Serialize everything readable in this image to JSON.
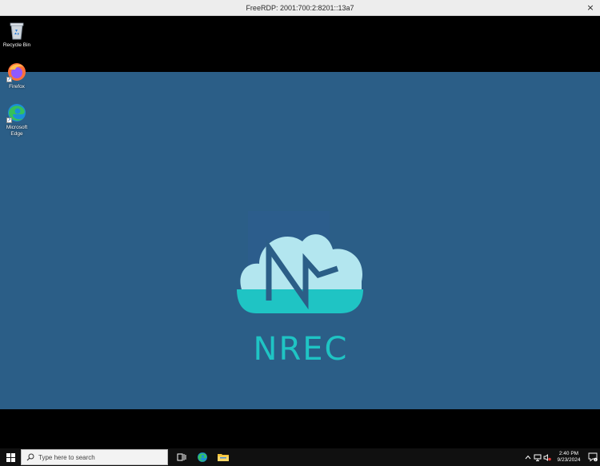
{
  "window": {
    "title": "FreeRDP: 2001:700:2:8201::13a7",
    "close_glyph": "×"
  },
  "desktop": {
    "icons": [
      {
        "label": "Recycle Bin",
        "icon": "recycle-bin-icon"
      },
      {
        "label": "Firefox",
        "icon": "firefox-icon"
      },
      {
        "label": "Microsoft Edge",
        "icon": "edge-icon"
      }
    ],
    "wallpaper": {
      "logo_text": "NREC",
      "background": "#2b5e87",
      "cloud_light": "#b3e6ef",
      "cloud_dark": "#1fc4c4"
    }
  },
  "taskbar": {
    "search_placeholder": "Type here to search",
    "apps": [
      "task-view-icon",
      "edge-icon",
      "file-explorer-icon"
    ],
    "tray": [
      "chevron-up-icon",
      "network-icon",
      "volume-icon"
    ],
    "clock": {
      "time": "2:40 PM",
      "date": "9/23/2024"
    },
    "notification_count": "1"
  }
}
